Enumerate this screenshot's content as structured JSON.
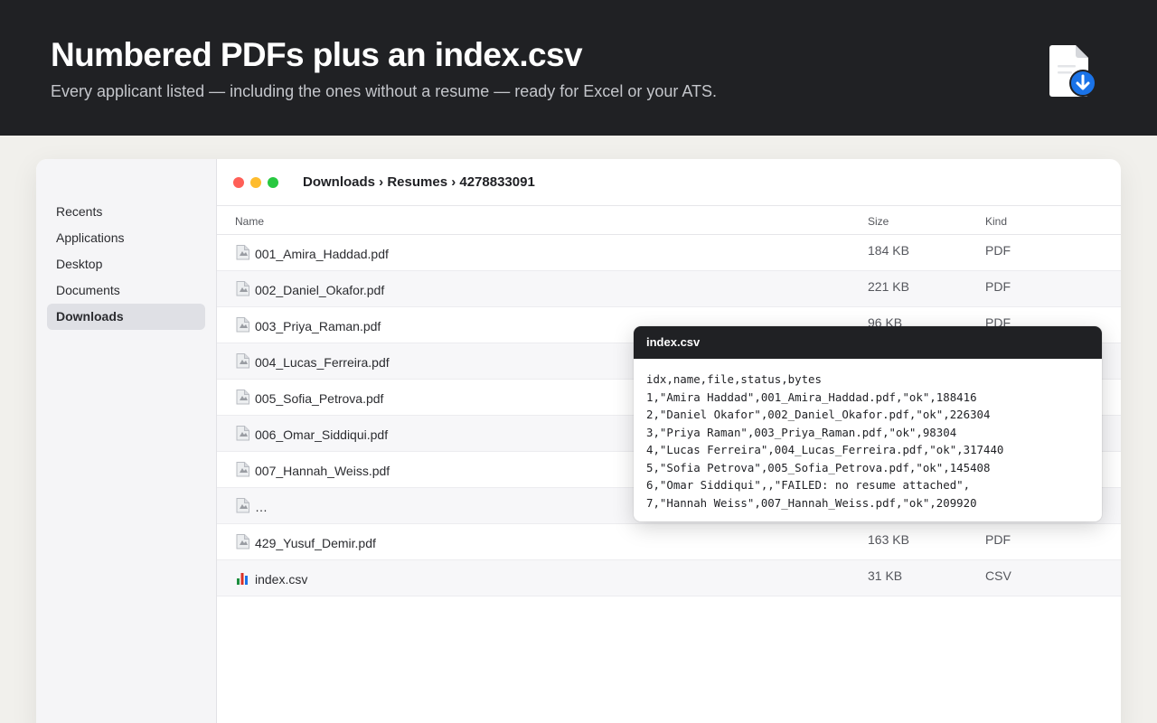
{
  "hero": {
    "title": "Numbered PDFs plus an index.csv",
    "subtitle": "Every applicant listed — including the ones without a resume — ready for Excel or your ATS.",
    "icon": "file-download-icon"
  },
  "sidebar": {
    "items": [
      {
        "label": "Recents"
      },
      {
        "label": "Applications"
      },
      {
        "label": "Desktop"
      },
      {
        "label": "Documents"
      },
      {
        "label": "Downloads",
        "active": true
      }
    ]
  },
  "titlebar": {
    "path": "Downloads › Resumes › 4278833091"
  },
  "columns": {
    "name": "Name",
    "size": "Size",
    "kind": "Kind"
  },
  "files": [
    {
      "name": "001_Amira_Haddad.pdf",
      "size": "184 KB",
      "kind": "PDF",
      "icon": "pdf-file-icon"
    },
    {
      "name": "002_Daniel_Okafor.pdf",
      "size": "221 KB",
      "kind": "PDF",
      "icon": "pdf-file-icon"
    },
    {
      "name": "003_Priya_Raman.pdf",
      "size": "96 KB",
      "kind": "PDF",
      "icon": "pdf-file-icon"
    },
    {
      "name": "004_Lucas_Ferreira.pdf",
      "size": "",
      "kind": "",
      "icon": "pdf-file-icon"
    },
    {
      "name": "005_Sofia_Petrova.pdf",
      "size": "",
      "kind": "",
      "icon": "pdf-file-icon"
    },
    {
      "name": "006_Omar_Siddiqui.pdf",
      "size": "",
      "kind": "",
      "icon": "pdf-file-icon"
    },
    {
      "name": "007_Hannah_Weiss.pdf",
      "size": "",
      "kind": "",
      "icon": "pdf-file-icon"
    },
    {
      "name": "…",
      "size": "",
      "kind": "",
      "icon": "pdf-file-icon"
    },
    {
      "name": "429_Yusuf_Demir.pdf",
      "size": "163 KB",
      "kind": "PDF",
      "icon": "pdf-file-icon"
    },
    {
      "name": "index.csv",
      "size": "31 KB",
      "kind": "CSV",
      "icon": "spreadsheet-file-icon"
    }
  ],
  "popup": {
    "title": "index.csv",
    "lines": [
      "idx,name,file,status,bytes",
      "1,\"Amira Haddad\",001_Amira_Haddad.pdf,\"ok\",188416",
      "2,\"Daniel Okafor\",002_Daniel_Okafor.pdf,\"ok\",226304",
      "3,\"Priya Raman\",003_Priya_Raman.pdf,\"ok\",98304",
      "4,\"Lucas Ferreira\",004_Lucas_Ferreira.pdf,\"ok\",317440",
      "5,\"Sofia Petrova\",005_Sofia_Petrova.pdf,\"ok\",145408",
      "6,\"Omar Siddiqui\",,\"FAILED: no resume attached\",",
      "7,\"Hannah Weiss\",007_Hannah_Weiss.pdf,\"ok\",209920"
    ]
  },
  "colors": {
    "hero_bg": "#202124",
    "accent_blue": "#1a73e8",
    "traffic_red": "#ff5f57",
    "traffic_yellow": "#febc2e",
    "traffic_green": "#28c840"
  }
}
